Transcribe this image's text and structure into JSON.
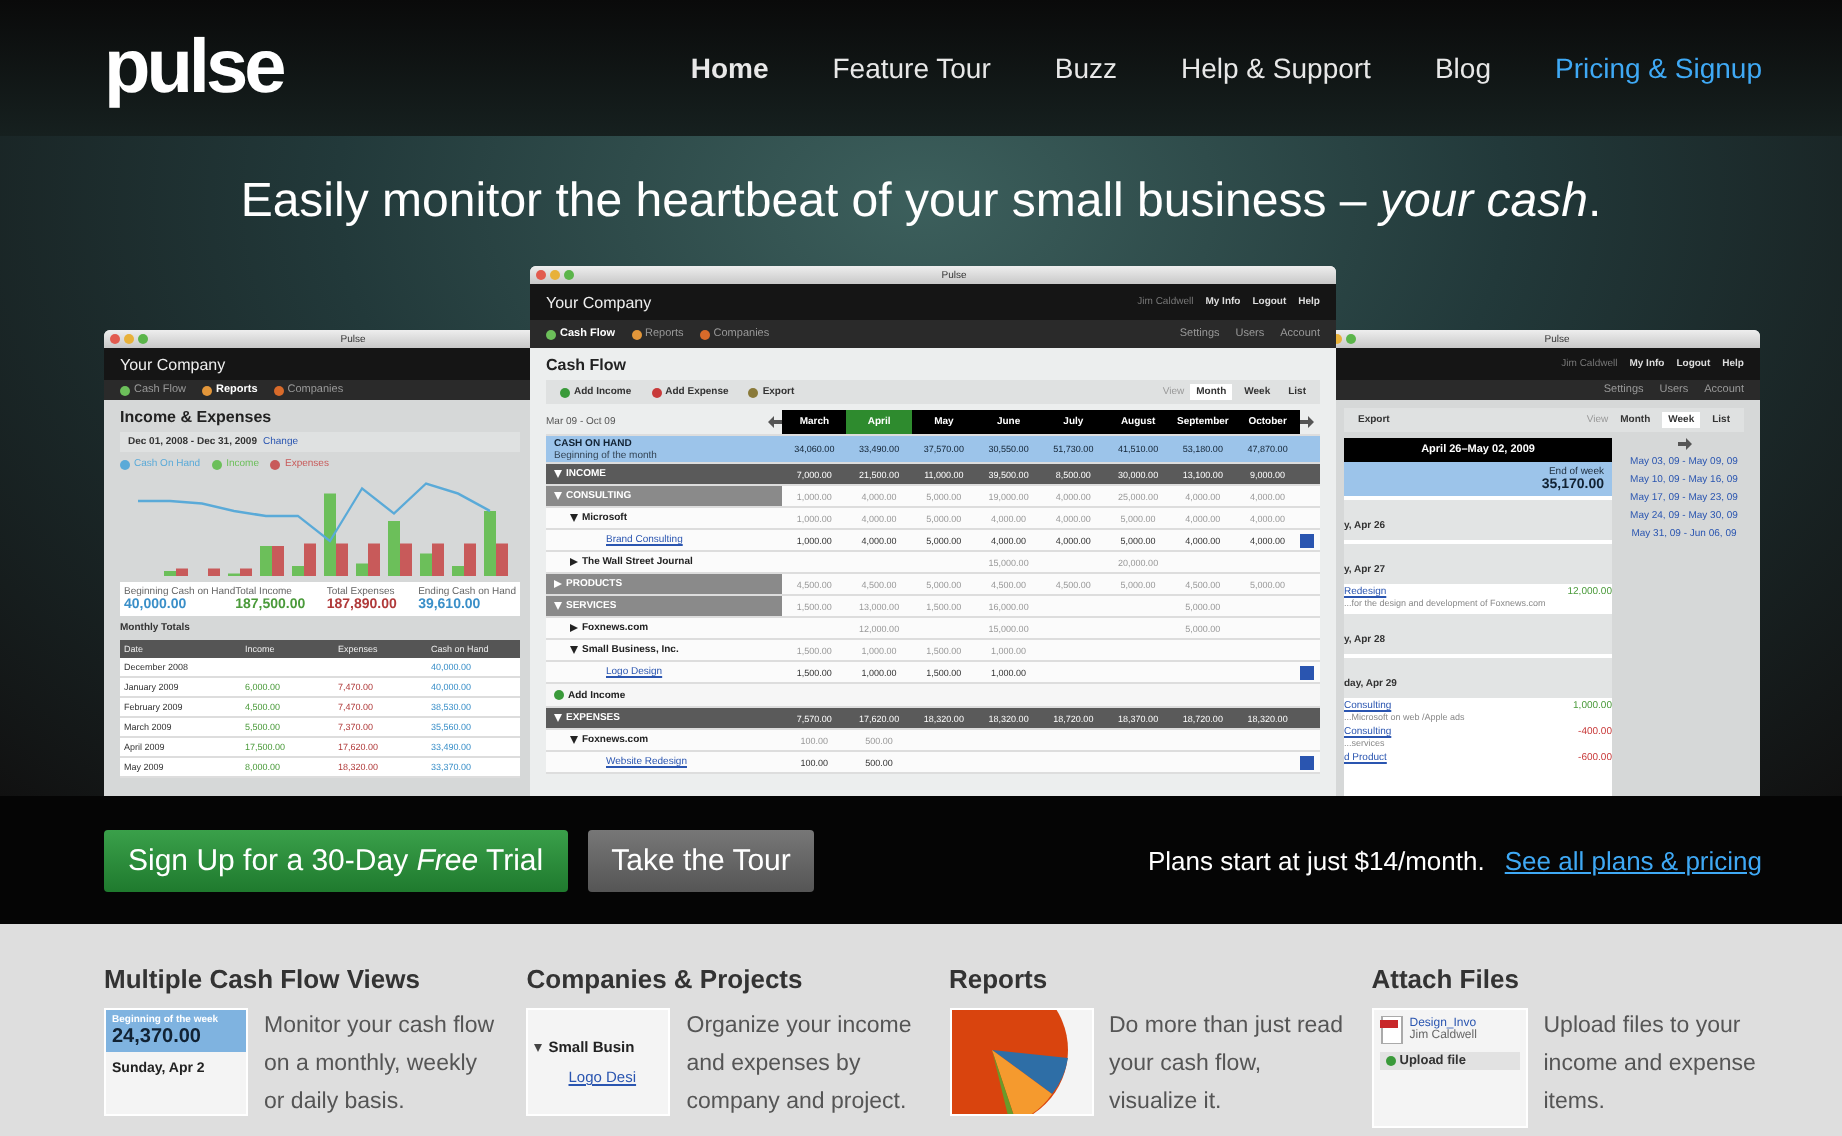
{
  "header": {
    "logo": "pulse",
    "nav": [
      {
        "label": "Home",
        "selected": true,
        "kind": "plain"
      },
      {
        "label": "Feature Tour",
        "selected": false,
        "kind": "plain"
      },
      {
        "label": "Buzz",
        "selected": false,
        "kind": "plain"
      },
      {
        "label": "Help & Support",
        "selected": false,
        "kind": "plain"
      },
      {
        "label": "Blog",
        "selected": false,
        "kind": "plain"
      },
      {
        "label": "Pricing & Signup",
        "selected": false,
        "kind": "accent"
      }
    ]
  },
  "headline": "Easily monitor the heartbeat of your small business – *your cash*.",
  "screens": {
    "left": {
      "title": "Pulse",
      "company": "Your Company",
      "tabs": [
        {
          "label": "Cash Flow",
          "selected": false
        },
        {
          "label": "Reports",
          "selected": true
        },
        {
          "label": "Companies",
          "selected": false
        }
      ],
      "heading": "Income & Expenses",
      "range": "Dec 01, 2008 - Dec 31, 2009",
      "change": "Change",
      "legend": [
        {
          "label": "Cash On Hand",
          "color": "#5aaad8"
        },
        {
          "label": "Income",
          "color": "#6cbf5a"
        },
        {
          "label": "Expenses",
          "color": "#c85a5a"
        }
      ],
      "summary": [
        {
          "label": "Beginning Cash on Hand",
          "value": "40,000.00",
          "color": "#3a8fc8"
        },
        {
          "label": "Total Income",
          "value": "187,500.00",
          "color": "#4a9a3a"
        },
        {
          "label": "Total Expenses",
          "value": "187,890.00",
          "color": "#b03a3a"
        },
        {
          "label": "Ending Cash on Hand",
          "value": "39,610.00",
          "color": "#3a8fc8"
        }
      ],
      "totals_title": "Monthly Totals",
      "columns": [
        "Date",
        "Income",
        "Expenses",
        "Cash on Hand"
      ],
      "rows": [
        {
          "date": "December 2008",
          "cash": "40,000.00"
        },
        {
          "date": "January 2009",
          "income": "6,000.00",
          "expenses": "7,470.00",
          "cash": "40,000.00"
        },
        {
          "date": "February 2009",
          "income": "4,500.00",
          "expenses": "7,470.00",
          "cash": "38,530.00"
        },
        {
          "date": "March 2009",
          "income": "5,500.00",
          "expenses": "7,370.00",
          "cash": "35,560.00"
        },
        {
          "date": "April 2009",
          "income": "17,500.00",
          "expenses": "17,620.00",
          "cash": "33,490.00"
        },
        {
          "date": "May 2009",
          "income": "8,000.00",
          "expenses": "18,320.00",
          "cash": "33,370.00"
        }
      ]
    },
    "center": {
      "title": "Pulse",
      "company": "Your Company",
      "user": [
        "Jim Caldwell",
        "My Info",
        "Logout",
        "Help"
      ],
      "tabs": [
        {
          "label": "Cash Flow",
          "selected": true
        },
        {
          "label": "Reports",
          "selected": false
        },
        {
          "label": "Companies",
          "selected": false
        }
      ],
      "admin": [
        "Settings",
        "Users",
        "Account"
      ],
      "heading": "Cash Flow",
      "actions": [
        "Add Income",
        "Add Expense",
        "Export"
      ],
      "view_label": "View",
      "views": [
        {
          "label": "Month",
          "selected": true
        },
        {
          "label": "Week",
          "selected": false
        },
        {
          "label": "List",
          "selected": false
        }
      ],
      "range": "Mar 09 - Oct 09",
      "months": [
        {
          "label": "March",
          "selected": false
        },
        {
          "label": "April",
          "selected": true
        },
        {
          "label": "May",
          "selected": false
        },
        {
          "label": "June",
          "selected": false
        },
        {
          "label": "July",
          "selected": false
        },
        {
          "label": "August",
          "selected": false
        },
        {
          "label": "September",
          "selected": false
        },
        {
          "label": "October",
          "selected": false
        }
      ],
      "rows": [
        {
          "kind": "cash",
          "label": "CASH ON HAND",
          "sub": "Beginning of the month",
          "values": {
            "col_1": "34,060.00",
            "col_2": "33,490.00",
            "col_3": "37,570.00",
            "col_4": "30,550.00",
            "col_5": "51,730.00",
            "col_6": "41,510.00",
            "col_7": "53,180.00",
            "col_8": "47,870.00"
          }
        },
        {
          "kind": "group",
          "label": "INCOME",
          "expanded": true,
          "values": {
            "col_1": "7,000.00",
            "col_2": "21,500.00",
            "col_3": "11,000.00",
            "col_4": "39,500.00",
            "col_5": "8,500.00",
            "col_6": "30,000.00",
            "col_7": "13,100.00",
            "col_8": "9,000.00"
          }
        },
        {
          "kind": "category",
          "label": "CONSULTING",
          "expanded": true,
          "values": {
            "col_1": "1,000.00",
            "col_2": "4,000.00",
            "col_3": "5,000.00",
            "col_4": "19,000.00",
            "col_5": "4,000.00",
            "col_6": "25,000.00",
            "col_7": "4,000.00",
            "col_8": "4,000.00"
          }
        },
        {
          "kind": "company",
          "label": "Microsoft",
          "expanded": true,
          "values": {
            "col_1": "1,000.00",
            "col_2": "4,000.00",
            "col_3": "5,000.00",
            "col_4": "4,000.00",
            "col_5": "4,000.00",
            "col_6": "5,000.00",
            "col_7": "4,000.00",
            "col_8": "4,000.00"
          }
        },
        {
          "kind": "project",
          "label": "Brand Consulting",
          "checked": true,
          "values": {
            "col_1": "1,000.00",
            "col_2": "4,000.00",
            "col_3": "5,000.00",
            "col_4": "4,000.00",
            "col_5": "4,000.00",
            "col_6": "5,000.00",
            "col_7": "4,000.00",
            "col_8": "4,000.00"
          }
        },
        {
          "kind": "company",
          "label": "The Wall Street Journal",
          "expanded": false,
          "values": {
            "col_4": "15,000.00",
            "col_6": "20,000.00"
          }
        },
        {
          "kind": "category",
          "label": "PRODUCTS",
          "expanded": false,
          "values": {
            "col_1": "4,500.00",
            "col_2": "4,500.00",
            "col_3": "5,000.00",
            "col_4": "4,500.00",
            "col_5": "4,500.00",
            "col_6": "5,000.00",
            "col_7": "4,500.00",
            "col_8": "5,000.00"
          }
        },
        {
          "kind": "category",
          "label": "SERVICES",
          "expanded": true,
          "values": {
            "col_1": "1,500.00",
            "col_2": "13,000.00",
            "col_3": "1,500.00",
            "col_4": "16,000.00",
            "col_7": "5,000.00"
          }
        },
        {
          "kind": "company",
          "label": "Foxnews.com",
          "expanded": false,
          "values": {
            "col_2": "12,000.00",
            "col_4": "15,000.00",
            "col_7": "5,000.00"
          }
        },
        {
          "kind": "company",
          "label": "Small Business, Inc.",
          "expanded": true,
          "values": {
            "col_1": "1,500.00",
            "col_2": "1,000.00",
            "col_3": "1,500.00",
            "col_4": "1,000.00"
          }
        },
        {
          "kind": "project",
          "label": "Logo Design",
          "checked": true,
          "values": {
            "col_1": "1,500.00",
            "col_2": "1,000.00",
            "col_3": "1,500.00",
            "col_4": "1,000.00"
          }
        },
        {
          "kind": "add",
          "label": "Add Income"
        },
        {
          "kind": "group",
          "label": "EXPENSES",
          "expanded": true,
          "values": {
            "col_1": "7,570.00",
            "col_2": "17,620.00",
            "col_3": "18,320.00",
            "col_4": "18,320.00",
            "col_5": "18,720.00",
            "col_6": "18,370.00",
            "col_7": "18,720.00",
            "col_8": "18,320.00"
          }
        },
        {
          "kind": "company",
          "label": "Foxnews.com",
          "expanded": true,
          "values": {
            "col_1": "100.00",
            "col_2": "500.00"
          }
        },
        {
          "kind": "project",
          "label": "Website Redesign",
          "checked": true,
          "values": {
            "col_1": "100.00",
            "col_2": "500.00"
          }
        }
      ]
    },
    "right": {
      "title": "Pulse",
      "user": [
        "Jim Caldwell",
        "My Info",
        "Logout",
        "Help"
      ],
      "admin": [
        "Settings",
        "Users",
        "Account"
      ],
      "action": "Export",
      "view_label": "View",
      "views": [
        {
          "label": "Month",
          "selected": false
        },
        {
          "label": "Week",
          "selected": true
        },
        {
          "label": "List",
          "selected": false
        }
      ],
      "week": "April 26–May 02, 2009",
      "end_label": "End of week",
      "end_value": "35,170.00",
      "days": [
        {
          "day": "y, Apr 26"
        },
        {
          "day": "y, Apr 27",
          "items": [
            {
              "name": "Redesign",
              "note": "...for the design and development of Foxnews.com",
              "amount": "12,000.00",
              "kind": "income"
            }
          ]
        },
        {
          "day": "y, Apr 28"
        },
        {
          "day": "day, Apr 29",
          "items": [
            {
              "name": "Consulting",
              "note": "...Microsoft on web /Apple ads",
              "amount": "1,000.00",
              "kind": "income"
            },
            {
              "name": "Consulting",
              "note": "...services",
              "amount": "-400.00",
              "kind": "expense"
            },
            {
              "name": "d Product",
              "amount": "-600.00",
              "kind": "expense"
            }
          ]
        }
      ],
      "weeks": [
        "May 03, 09 - May 09, 09",
        "May 10, 09 - May 16, 09",
        "May 17, 09 - May 23, 09",
        "May 24, 09 - May 30, 09",
        "May 31, 09 - Jun 06, 09"
      ]
    }
  },
  "cta": {
    "signup": "Sign Up for a 30-Day *Free* Trial",
    "tour": "Take the Tour",
    "plans_text": "Plans start at just $14/month.",
    "plans_link": "See all plans & pricing"
  },
  "features": [
    {
      "kind": "views",
      "title": "Multiple Cash Flow Views",
      "text": "Monitor your cash flow on a monthly, weekly or daily basis.",
      "thumb": [
        "Beginning of the week",
        "24,370.00",
        "Sunday, Apr 2"
      ]
    },
    {
      "kind": "companies",
      "title": "Companies & Projects",
      "text": "Organize your income and expenses by company and project.",
      "thumb": [
        "Small Busin",
        "Logo Desi"
      ]
    },
    {
      "kind": "reports",
      "title": "Reports",
      "text": "Do more than just read your cash flow, visualize it."
    },
    {
      "kind": "files",
      "title": "Attach Files",
      "text": "Upload files to your income and expense items.",
      "thumb": [
        "Design_Invo",
        "Jim Caldwell",
        "Upload file"
      ]
    }
  ]
}
